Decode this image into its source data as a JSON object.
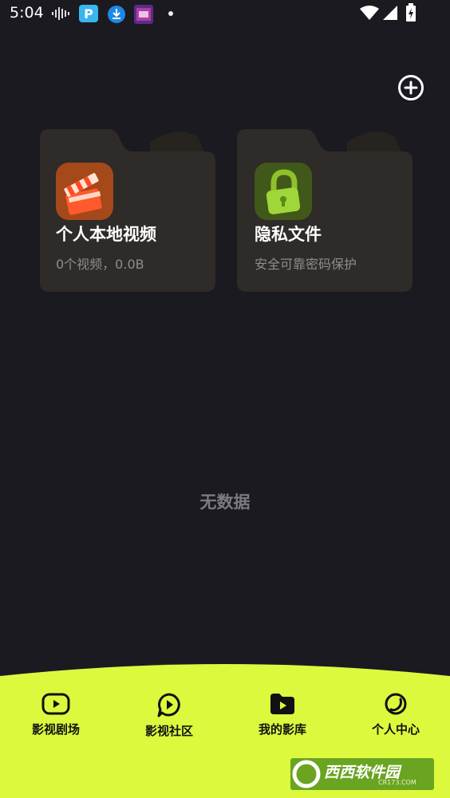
{
  "status_bar": {
    "time": "5:04",
    "icons_left": [
      "sound-wave-icon",
      "p-app-icon",
      "download-icon",
      "game-app-icon",
      "dot-icon"
    ],
    "icons_right": [
      "wifi-icon",
      "signal-icon",
      "battery-icon"
    ]
  },
  "header": {
    "add_icon": "plus-circle-icon"
  },
  "folders": [
    {
      "title": "个人本地视频",
      "subtitle": "0个视频，0.0B",
      "icon": "clapperboard-icon"
    },
    {
      "title": "隐私文件",
      "subtitle": "安全可靠密码保护",
      "icon": "lock-icon"
    }
  ],
  "empty_text": "无数据",
  "bottom_nav": {
    "items": [
      {
        "label": "影视剧场",
        "icon": "play-tv-icon"
      },
      {
        "label": "影视社区",
        "icon": "play-bubble-icon"
      },
      {
        "label": "我的影库",
        "icon": "folder-play-icon"
      },
      {
        "label": "个人中心",
        "icon": "moon-icon"
      }
    ],
    "active_index": 2
  },
  "watermark": {
    "text": "西西软件园",
    "domain": "CR173.COM"
  },
  "colors": {
    "background": "#1b1a21",
    "card": "#2f2b28",
    "accent": "#dcf93e",
    "muted": "#8f8c8a"
  }
}
